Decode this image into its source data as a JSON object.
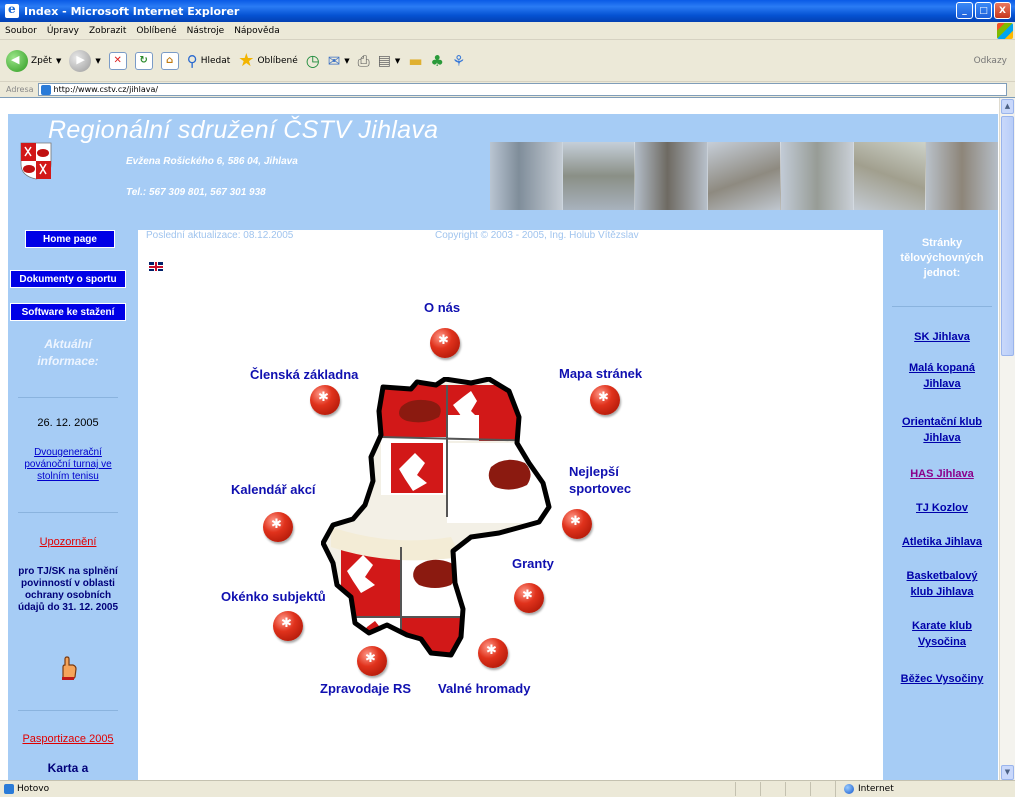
{
  "window": {
    "title": "Index - Microsoft Internet Explorer",
    "minimize": "_",
    "maximize": "□",
    "close": "X"
  },
  "menu": [
    "Soubor",
    "Úpravy",
    "Zobrazit",
    "Oblíbené",
    "Nástroje",
    "Nápověda"
  ],
  "toolbar": {
    "back": "Zpět",
    "search": "Hledat",
    "favorites": "Oblíbené",
    "links": "Odkazy"
  },
  "address": {
    "label": "Adresa",
    "url": "http://www.cstv.cz/jihlava/"
  },
  "header": {
    "title": "Regionální sdružení ČSTV Jihlava",
    "address": "Evžena Rošického 6, 586 04, Jihlava",
    "phone": "Tel.: 567 309 801, 567 301 938"
  },
  "left": {
    "home": "Home page",
    "documents": "Dokumenty o sportu",
    "software": "Software ke stažení",
    "news_heading": "Aktuální informace:",
    "news_date": "26. 12. 2005",
    "news_link": "Dvougenerační povánoční turnaj ve stolním tenisu",
    "warning": "Upozornění",
    "warning_text": "pro TJ/SK na splnění povinností v oblasti ochrany osobních údajů do 31. 12. 2005",
    "pasport": "Pasportizace 2005",
    "karta": "Karta a"
  },
  "main": {
    "updated": "Poslední aktualizace:   08.12.2005",
    "copyright": "Copyright © 2003 - 2005, Ing. Holub Vítězslav",
    "nav": {
      "o_nas": "O nás",
      "clenska": "Členská základna",
      "mapa": "Mapa stránek",
      "nejlepsi_1": "Nejlepší",
      "nejlepsi_2": "sportovec",
      "kalendar": "Kalendář akcí",
      "granty": "Granty",
      "okenko": "Okénko subjektů",
      "zpravodaje": "Zpravodaje RS",
      "valne": "Valné hromady"
    }
  },
  "right": {
    "heading": "Stránky tělovýchovných jednot:",
    "links": [
      "SK Jihlava",
      "Malá kopaná Jihlava",
      "Orientační klub Jihlava",
      "HAS Jihlava",
      "TJ Kozlov",
      "Atletika Jihlava",
      "Basketbalový klub Jihlava",
      "Karate klub Vysočina",
      "Běžec Vysočiny"
    ]
  },
  "status": {
    "text": "Hotovo",
    "zone": "Internet"
  },
  "colors": {
    "page_bg": "#a6ccf5",
    "nav_button": "#0000e6",
    "link_label": "#1010b0",
    "crest_red": "#d21818"
  }
}
